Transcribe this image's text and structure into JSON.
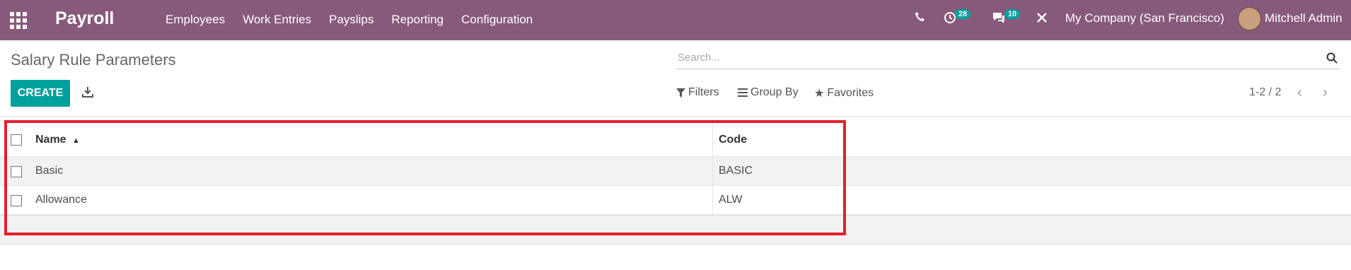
{
  "navbar": {
    "app_title": "Payroll",
    "menu": [
      "Employees",
      "Work Entries",
      "Payslips",
      "Reporting",
      "Configuration"
    ],
    "activity_count": "28",
    "message_count": "10",
    "company": "My Company (San Francisco)",
    "user": "Mitchell Admin"
  },
  "page": {
    "title": "Salary Rule Parameters"
  },
  "search": {
    "placeholder": "Search..."
  },
  "toolbar": {
    "create_label": "CREATE",
    "filters_label": "Filters",
    "groupby_label": "Group By",
    "favorites_label": "Favorites",
    "pager": "1-2 / 2"
  },
  "table": {
    "columns": [
      "Name",
      "Code"
    ],
    "rows": [
      {
        "name": "Basic",
        "code": "BASIC"
      },
      {
        "name": "Allowance",
        "code": "ALW"
      }
    ]
  },
  "colors": {
    "navbar": "#875a7b",
    "primary": "#00a09d",
    "highlight": "#e31e2b"
  }
}
